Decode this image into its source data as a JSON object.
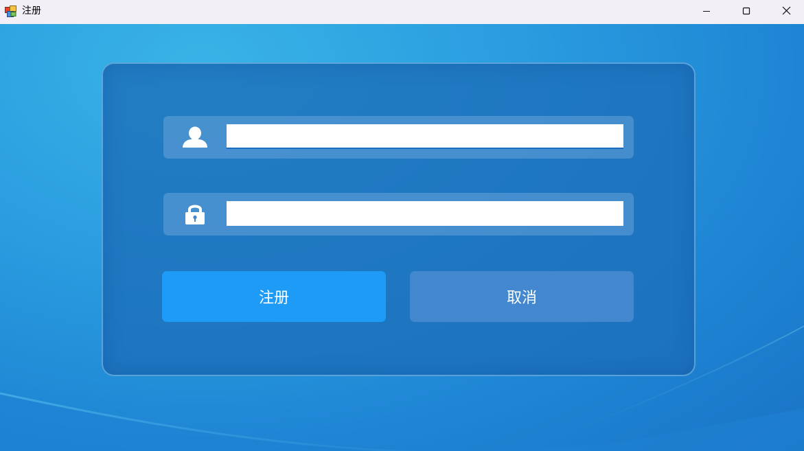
{
  "window": {
    "title": "注册",
    "icon": "app-window-icon",
    "controls": [
      "minimize-icon",
      "maximize-icon",
      "close-icon"
    ]
  },
  "form": {
    "username": {
      "icon": "user-icon",
      "value": "",
      "placeholder": ""
    },
    "password": {
      "icon": "lock-icon",
      "value": "",
      "placeholder": ""
    },
    "register_label": "注册",
    "cancel_label": "取消"
  },
  "colors": {
    "titlebar": "#f3eff6",
    "background": "#2b9ee0",
    "panel": "#1c6eb9",
    "register_button": "#1e9bf7",
    "cancel_button": "#4387cf"
  }
}
